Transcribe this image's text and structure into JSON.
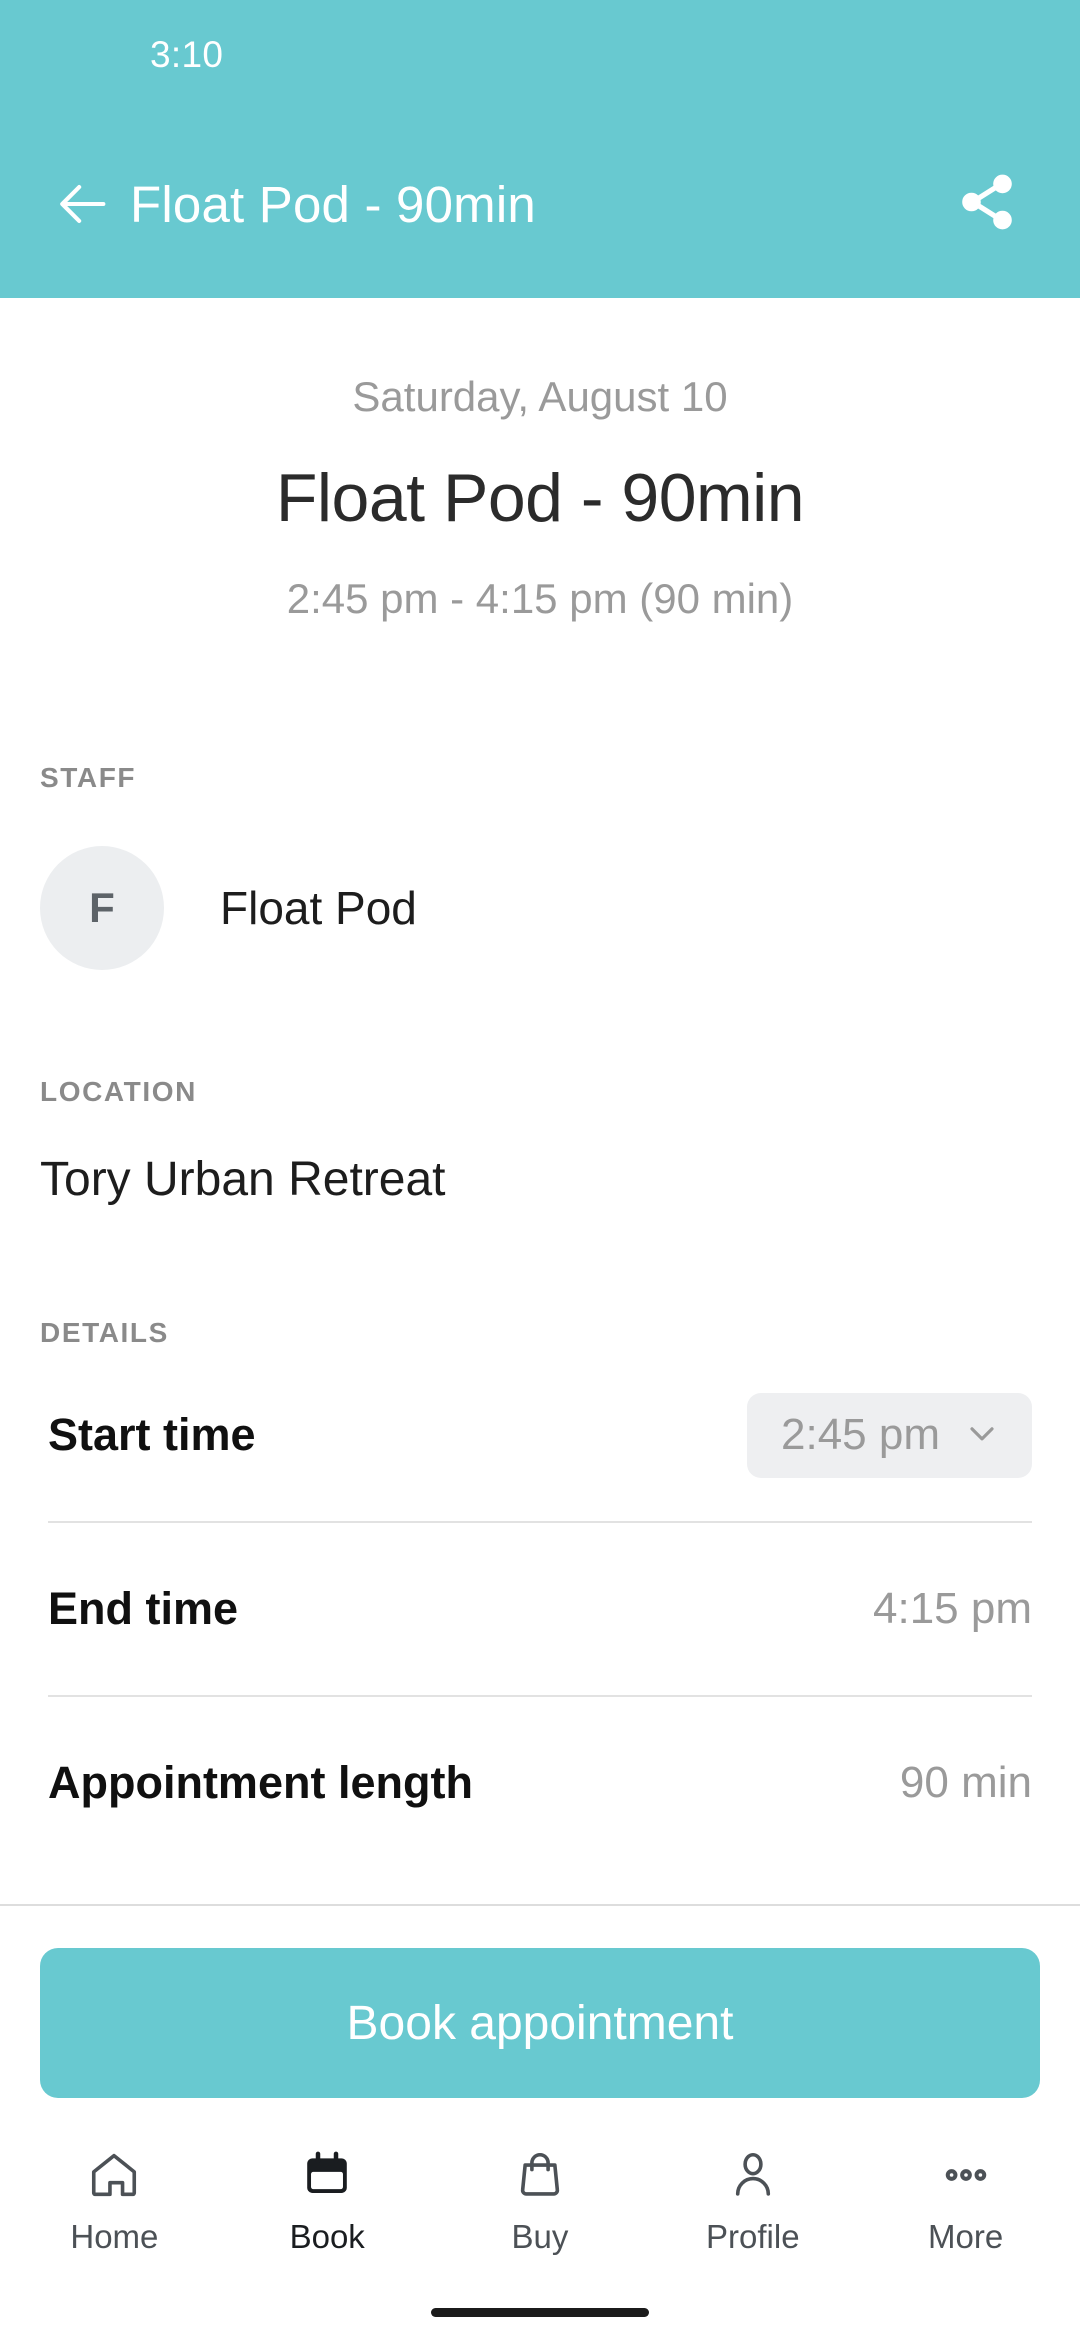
{
  "status_bar": {
    "time": "3:10"
  },
  "app_bar": {
    "title": "Float Pod - 90min",
    "back_icon": "arrow-left-icon",
    "share_icon": "share-icon",
    "background_color": "#68C9D0"
  },
  "hero": {
    "date": "Saturday, August 10",
    "title": "Float Pod - 90min",
    "time_range": "2:45 pm - 4:15 pm (90 min)"
  },
  "staff": {
    "label": "STAFF",
    "avatar_initial": "F",
    "name": "Float Pod"
  },
  "location": {
    "label": "LOCATION",
    "value": "Tory Urban Retreat"
  },
  "details": {
    "label": "DETAILS",
    "rows": [
      {
        "label": "Start time",
        "value": "2:45 pm",
        "type": "dropdown",
        "icon": "chevron-down-icon"
      },
      {
        "label": "End time",
        "value": "4:15 pm",
        "type": "text"
      },
      {
        "label": "Appointment length",
        "value": "90 min",
        "type": "text"
      }
    ]
  },
  "cta": {
    "label": "Book appointment",
    "color": "#68C9D0"
  },
  "bottom_nav": {
    "active_index": 1,
    "items": [
      {
        "label": "Home",
        "icon": "home-icon"
      },
      {
        "label": "Book",
        "icon": "calendar-icon"
      },
      {
        "label": "Buy",
        "icon": "shopping-bag-icon"
      },
      {
        "label": "Profile",
        "icon": "person-icon"
      },
      {
        "label": "More",
        "icon": "ellipsis-icon"
      }
    ]
  }
}
